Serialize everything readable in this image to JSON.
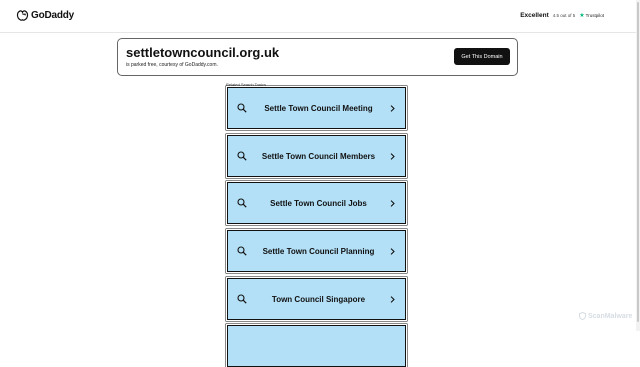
{
  "header": {
    "logo_text": "GoDaddy",
    "rating": {
      "word": "Excellent",
      "score": "4.5 out of 5",
      "provider": "Trustpilot"
    }
  },
  "domain": {
    "name": "settletowncouncil.org.uk",
    "note": "is parked free, courtesy of GoDaddy.com.",
    "cta_label": "Get This Domain"
  },
  "related": {
    "label": "Related Search Topics",
    "topics": [
      {
        "label": "Settle Town Council Meeting"
      },
      {
        "label": "Settle Town Council Members"
      },
      {
        "label": "Settle Town Council Jobs"
      },
      {
        "label": "Settle Town Council Planning"
      },
      {
        "label": "Town Council Singapore"
      },
      {
        "label": ""
      }
    ]
  },
  "watermark": "ScanMalware",
  "icons": {
    "logo": "godaddy-logo-icon",
    "search": "search-icon",
    "chevron": "chevron-right-icon",
    "star": "trustpilot-star-icon"
  },
  "colors": {
    "topic_bg": "#b3e0f7",
    "topic_border": "#111111",
    "cta_bg": "#111111",
    "trustpilot_green": "#00b67a"
  }
}
